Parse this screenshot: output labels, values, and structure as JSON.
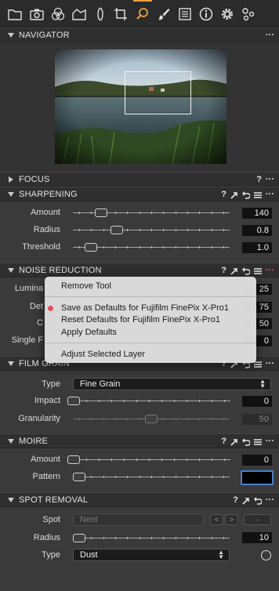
{
  "toolbar": {
    "icons": [
      "library-icon",
      "camera-icon",
      "color-icon",
      "exposure-icon",
      "lens-icon",
      "crop-icon",
      "details-icon",
      "local-adjustments-icon",
      "metadata-icon",
      "info-icon",
      "settings-icon",
      "batch-icon"
    ],
    "active_icon": "details-icon",
    "accent": "#e8a23c"
  },
  "navigator": {
    "title": "NAVIGATOR",
    "more": "···"
  },
  "focus": {
    "title": "FOCUS",
    "help": "?",
    "more": "···"
  },
  "sharpening": {
    "title": "SHARPENING",
    "help": "?",
    "more": "···",
    "rows": [
      {
        "label": "Amount",
        "value": "140",
        "level": 0.15
      },
      {
        "label": "Radius",
        "value": "0.8",
        "level": 0.26
      },
      {
        "label": "Threshold",
        "value": "1.0",
        "level": 0.08
      }
    ]
  },
  "noise_reduction": {
    "title": "NOISE REDUCTION",
    "help": "?",
    "more": "···",
    "rows": [
      {
        "label": "Lumina",
        "value": "25"
      },
      {
        "label": "Det",
        "value": "75"
      },
      {
        "label": "C",
        "value": "50"
      },
      {
        "label": "Single F",
        "value": "0"
      }
    ]
  },
  "context_menu": {
    "items": [
      "Remove Tool",
      "Save as Defaults for Fujifilm FinePix X-Pro1",
      "Reset Defaults for Fujifilm FinePix X-Pro1",
      "Apply Defaults",
      "Adjust Selected Layer"
    ],
    "dot_color": "#e0505a"
  },
  "film_grain": {
    "title": "FILM GRAIN",
    "help": "?",
    "more": "···",
    "type_label": "Type",
    "type_value": "Fine Grain",
    "impact_label": "Impact",
    "impact_value": "0",
    "impact_level": 0.0,
    "granularity_label": "Granularity",
    "granularity_value": "50",
    "granularity_level": 0.5
  },
  "moire": {
    "title": "MOIRE",
    "help": "?",
    "more": "···",
    "amount_label": "Amount",
    "amount_value": "0",
    "amount_level": 0.0,
    "pattern_label": "Pattern",
    "pattern_value": "",
    "pattern_level": 0.0
  },
  "spot_removal": {
    "title": "SPOT REMOVAL",
    "help": "?",
    "more": "···",
    "spot_label": "Spot",
    "spot_value": "Next",
    "prev": "<",
    "next": ">",
    "minus": "-",
    "radius_label": "Radius",
    "radius_value": "10",
    "radius_level": 0.0,
    "type_label": "Type",
    "type_value": "Dust"
  }
}
